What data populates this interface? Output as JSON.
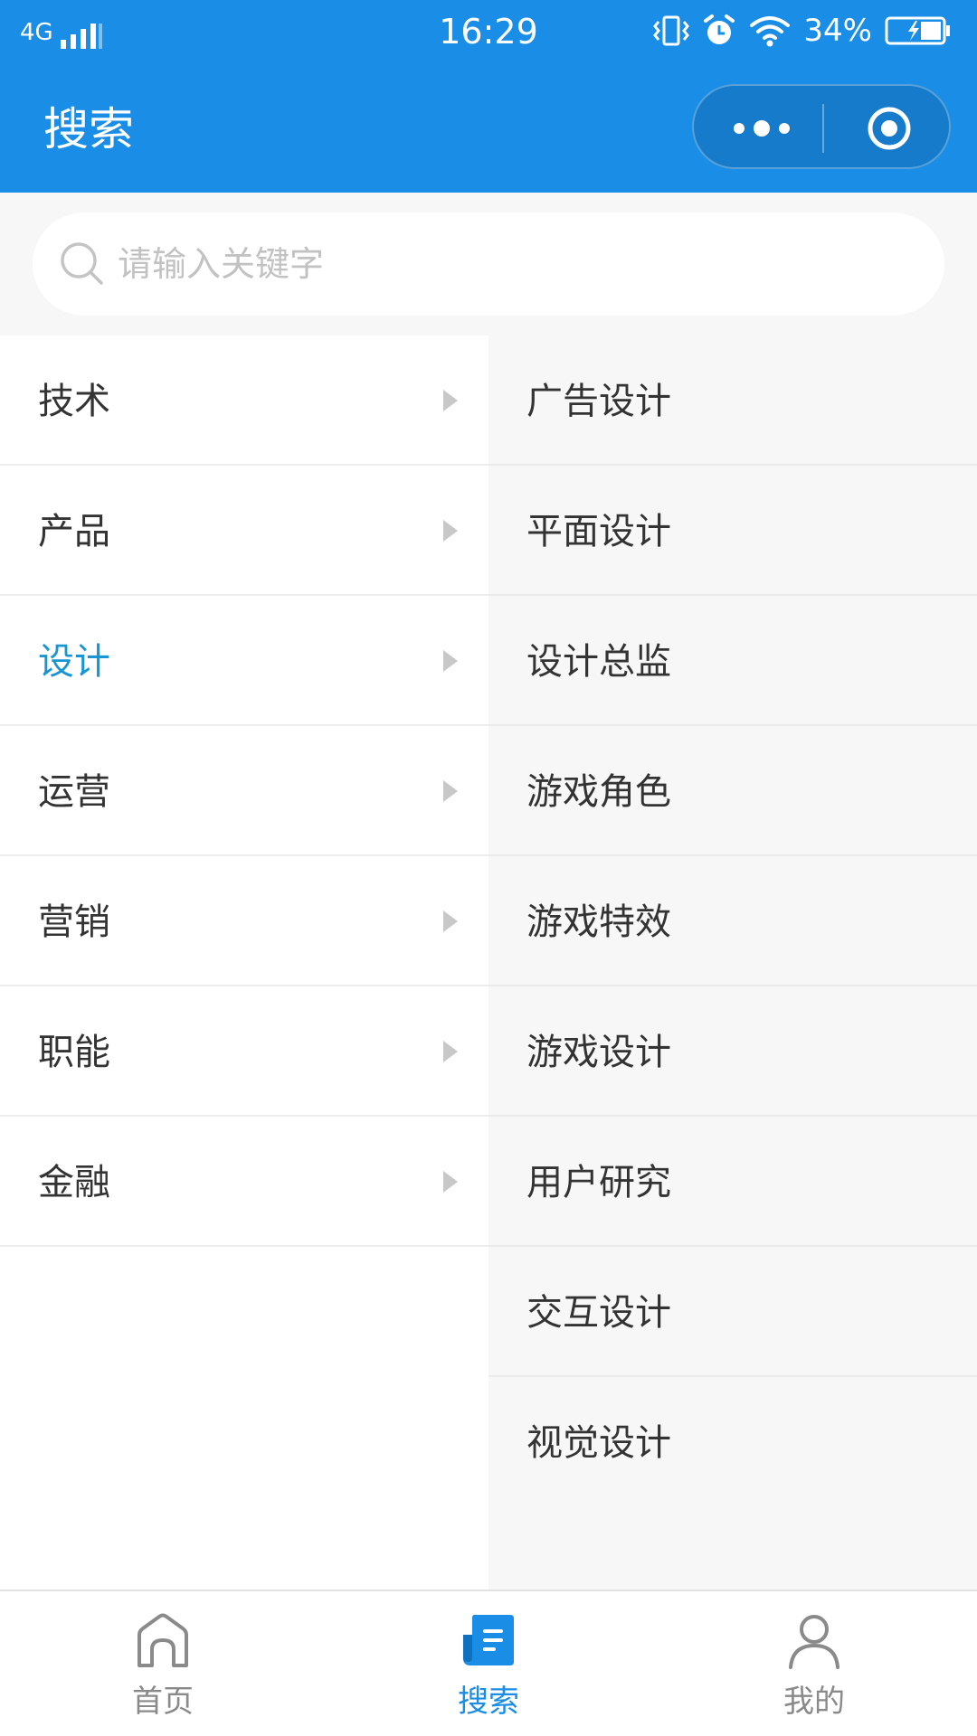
{
  "status_bar": {
    "network": "4G",
    "time": "16:29",
    "battery": "34%"
  },
  "nav": {
    "title": "搜索"
  },
  "search": {
    "placeholder": "请输入关键字",
    "value": ""
  },
  "categories": [
    {
      "label": "技术"
    },
    {
      "label": "产品"
    },
    {
      "label": "设计"
    },
    {
      "label": "运营"
    },
    {
      "label": "营销"
    },
    {
      "label": "职能"
    },
    {
      "label": "金融"
    }
  ],
  "active_category": "设计",
  "subcategories": [
    {
      "label": "广告设计"
    },
    {
      "label": "平面设计"
    },
    {
      "label": "设计总监"
    },
    {
      "label": "游戏角色"
    },
    {
      "label": "游戏特效"
    },
    {
      "label": "游戏设计"
    },
    {
      "label": "用户研究"
    },
    {
      "label": "交互设计"
    },
    {
      "label": "视觉设计"
    }
  ],
  "tabbar": {
    "active": "搜索",
    "tabs": [
      {
        "label": "首页",
        "icon": "home-icon"
      },
      {
        "label": "搜索",
        "icon": "document-icon"
      },
      {
        "label": "我的",
        "icon": "person-icon"
      }
    ]
  },
  "colors": {
    "brand": "#1a8de6",
    "active_text": "#1a95d4",
    "tab_inactive": "#8a8a8a"
  }
}
